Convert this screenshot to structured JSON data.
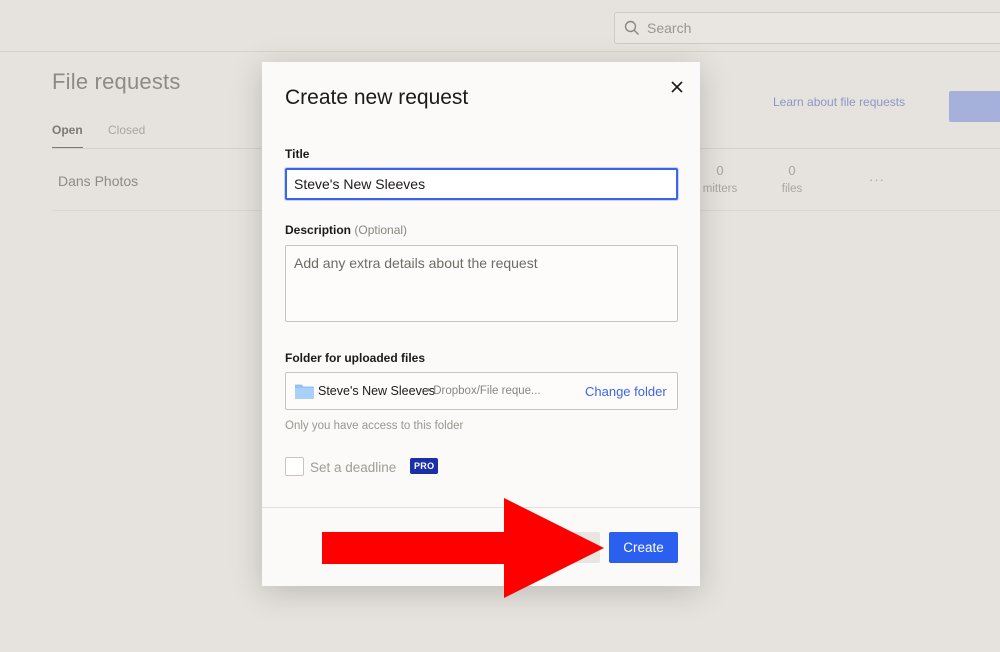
{
  "background": {
    "search": {
      "placeholder": "Search"
    },
    "page_title": "File requests",
    "learn_link": "Learn about file requests",
    "tabs": [
      {
        "label": "Open",
        "active": true
      },
      {
        "label": "Closed",
        "active": false
      }
    ],
    "rows": [
      {
        "name": "Dans Photos",
        "submitters": {
          "value": "0",
          "label": "mitters"
        },
        "files": {
          "value": "0",
          "label": "files"
        },
        "more": "···"
      }
    ]
  },
  "modal": {
    "title": "Create new request",
    "title_field": {
      "label": "Title",
      "value": "Steve's New Sleeves"
    },
    "description_field": {
      "label": "Description",
      "optional": "(Optional)",
      "placeholder": "Add any extra details about the request"
    },
    "folder_field": {
      "label": "Folder for uploaded files",
      "folder_name": "Steve's New Sleeves",
      "folder_path": "• Dropbox/File reque...",
      "change_label": "Change folder",
      "note": "Only you have access to this folder"
    },
    "deadline": {
      "label": "Set a deadline",
      "badge": "PRO",
      "checked": false
    },
    "create_label": "Create"
  },
  "colors": {
    "accent": "#2a5ff0",
    "annotation_arrow": "#ff0000",
    "pro_badge": "#1a2fa8"
  }
}
